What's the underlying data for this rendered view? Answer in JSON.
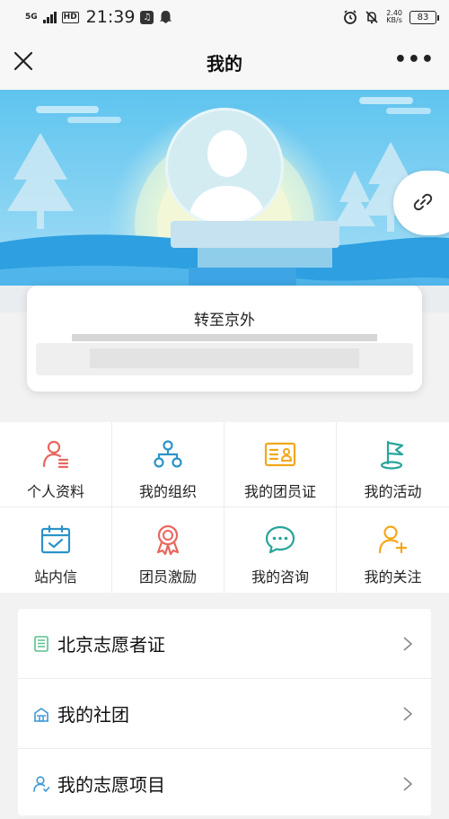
{
  "status_bar": {
    "network": "5G",
    "hd": "HD",
    "time": "21:39",
    "speed_value": "2.40",
    "speed_unit": "KB/s",
    "battery": "83"
  },
  "nav": {
    "title": "我的"
  },
  "profile": {
    "transfer_label": "转至京外"
  },
  "menu": [
    {
      "label": "个人资料",
      "icon": "person-profile-icon",
      "color": "#e8665f"
    },
    {
      "label": "我的组织",
      "icon": "organization-icon",
      "color": "#2b93c9"
    },
    {
      "label": "我的团员证",
      "icon": "member-card-icon",
      "color": "#f3a81a"
    },
    {
      "label": "我的活动",
      "icon": "flag-icon",
      "color": "#28a59a"
    },
    {
      "label": "站内信",
      "icon": "calendar-check-icon",
      "color": "#2b93c9"
    },
    {
      "label": "团员激励",
      "icon": "medal-icon",
      "color": "#e8665f"
    },
    {
      "label": "我的咨询",
      "icon": "chat-bubble-icon",
      "color": "#28a59a"
    },
    {
      "label": "我的关注",
      "icon": "add-person-icon",
      "color": "#f3a81a"
    }
  ],
  "list": [
    {
      "label": "北京志愿者证",
      "icon": "document-icon",
      "color": "#5bbf8c"
    },
    {
      "label": "我的社团",
      "icon": "building-icon",
      "color": "#3b97d3"
    },
    {
      "label": "我的志愿项目",
      "icon": "person-icon",
      "color": "#3b97d3"
    }
  ]
}
